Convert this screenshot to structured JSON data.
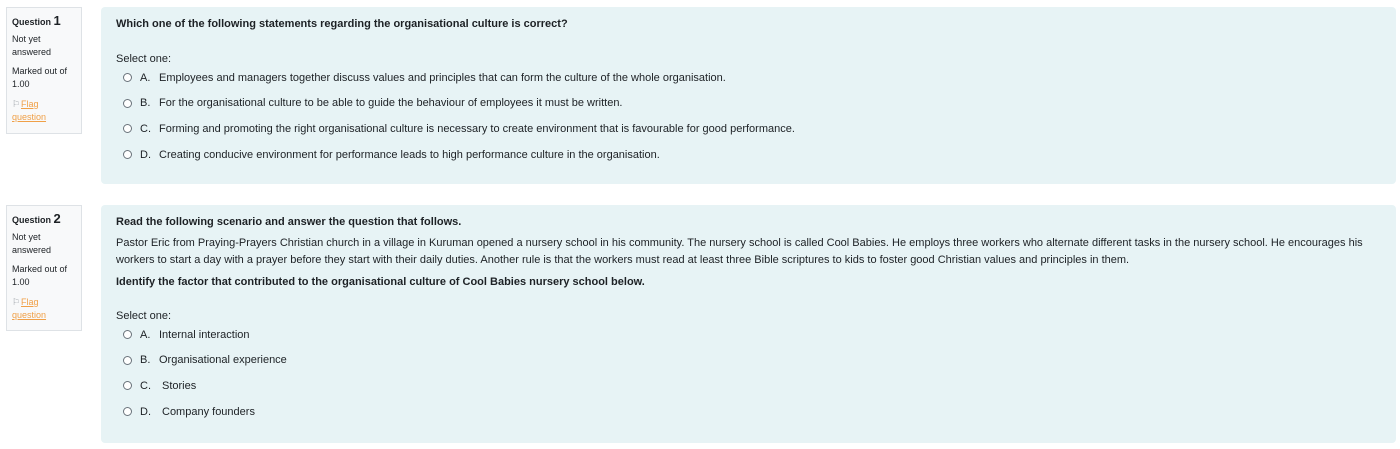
{
  "questions": [
    {
      "label": "Question",
      "number": "1",
      "state": [
        "Not yet",
        "answered"
      ],
      "grade": [
        "Marked out of",
        "1.00"
      ],
      "flag": [
        "Flag",
        "question"
      ],
      "text": "Which one of the following statements regarding the organisational culture is correct?",
      "prompt": "Select one:",
      "answers": [
        {
          "letter": "A.",
          "text": "Employees and managers together discuss values and principles that can form the culture of the whole organisation."
        },
        {
          "letter": "B.",
          "text": "For the organisational culture to be able to guide the behaviour of employees it must be written."
        },
        {
          "letter": "C.",
          "text": "Forming and promoting the right organisational culture is necessary to create environment that is favourable for good performance."
        },
        {
          "letter": "D.",
          "text": "Creating conducive environment for performance leads to high performance culture in the organisation."
        }
      ]
    },
    {
      "label": "Question",
      "number": "2",
      "state": [
        "Not yet",
        "answered"
      ],
      "grade": [
        "Marked out of",
        "1.00"
      ],
      "flag": [
        "Flag",
        "question"
      ],
      "intro": "Read the following scenario and answer the question that follows.",
      "scenario": "Pastor Eric from Praying-Prayers Christian church in a village in Kuruman opened a nursery school in his community. The nursery school is called Cool Babies.  He employs three workers who alternate different tasks in the nursery school. He encourages his workers to start a day with a prayer before they start with their daily duties.  Another rule is that the workers must read at least three Bible scriptures to kids to foster good Christian values and principles in them.",
      "text": "Identify the factor that contributed to the organisational culture of Cool Babies nursery school below.",
      "prompt": "Select one:",
      "answers": [
        {
          "letter": "A.",
          "text": "Internal interaction"
        },
        {
          "letter": "B.",
          "text": "Organisational experience"
        },
        {
          "letter": "C.",
          "text": "Stories"
        },
        {
          "letter": "D.",
          "text": "Company founders"
        }
      ]
    }
  ]
}
